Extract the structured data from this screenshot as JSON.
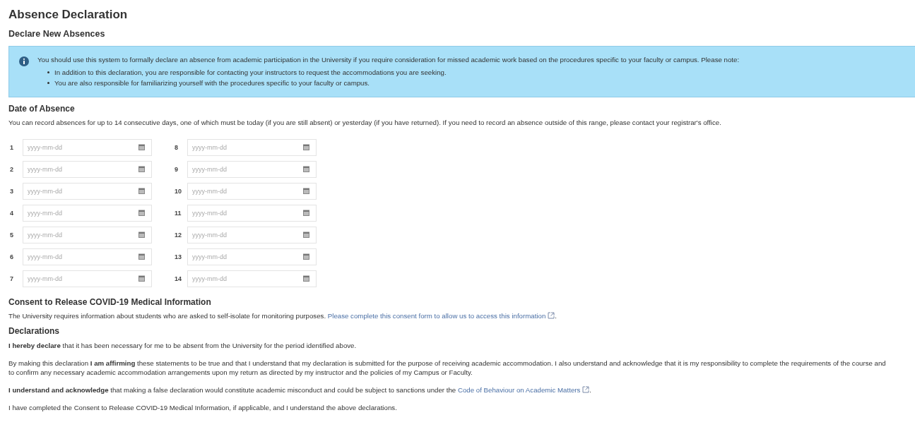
{
  "title": "Absence Declaration",
  "subtitle": "Declare New Absences",
  "info": {
    "text": "You should use this system to formally declare an absence from academic participation in the University if you require consideration for missed academic work based on the procedures specific to your faculty or campus. Please note:",
    "bullets": [
      "In addition to this declaration, you are responsible for contacting your instructors to request the accommodations you are seeking.",
      "You are also responsible for familiarizing yourself with the procedures specific to your faculty or campus."
    ]
  },
  "date_section": {
    "heading": "Date of Absence",
    "text": "You can record absences for up to 14 consecutive days, one of which must be today (if you are still absent) or yesterday (if you have returned). If you need to record an absence outside of this range, please contact your registrar's office.",
    "dates": [
      {
        "number": "1",
        "placeholder": "yyyy-mm-dd"
      },
      {
        "number": "2",
        "placeholder": "yyyy-mm-dd"
      },
      {
        "number": "3",
        "placeholder": "yyyy-mm-dd"
      },
      {
        "number": "4",
        "placeholder": "yyyy-mm-dd"
      },
      {
        "number": "5",
        "placeholder": "yyyy-mm-dd"
      },
      {
        "number": "6",
        "placeholder": "yyyy-mm-dd"
      },
      {
        "number": "7",
        "placeholder": "yyyy-mm-dd"
      },
      {
        "number": "8",
        "placeholder": "yyyy-mm-dd"
      },
      {
        "number": "9",
        "placeholder": "yyyy-mm-dd"
      },
      {
        "number": "10",
        "placeholder": "yyyy-mm-dd"
      },
      {
        "number": "11",
        "placeholder": "yyyy-mm-dd"
      },
      {
        "number": "12",
        "placeholder": "yyyy-mm-dd"
      },
      {
        "number": "13",
        "placeholder": "yyyy-mm-dd"
      },
      {
        "number": "14",
        "placeholder": "yyyy-mm-dd"
      }
    ]
  },
  "consent": {
    "heading": "Consent to Release COVID-19 Medical Information",
    "text": "The University requires information about students who are asked to self-isolate for monitoring purposes.",
    "link": "Please complete this consent form to allow us to access this information",
    "after": "."
  },
  "declarations": {
    "heading": "Declarations",
    "paragraphs": [
      {
        "lines": [
          "**I hereby declare** that it has been necessary for me to be absent from the University for the period identified above."
        ]
      },
      {
        "lines": [
          "By making this declaration **I am affirming** these statements to be true and that I understand that my declaration is submitted for the purpose of receiving academic accommodation. I also understand and acknowledge that it is my responsibility to complete the requirements of the course and",
          "to confirm any necessary academic accommodation arrangements upon my return as directed by my instructor and the policies of my Campus or Faculty."
        ]
      },
      {
        "lines": [
          "**I understand and acknowledge** that making a false declaration would constitute academic misconduct and could be subject to sanctions under the"
        ],
        "link": "Code of Behaviour on Academic Matters",
        "after": "."
      },
      {
        "lines": [
          "I have completed the Consent to Release COVID-19 Medical Information, if applicable, and I understand the above declarations."
        ]
      }
    ]
  }
}
